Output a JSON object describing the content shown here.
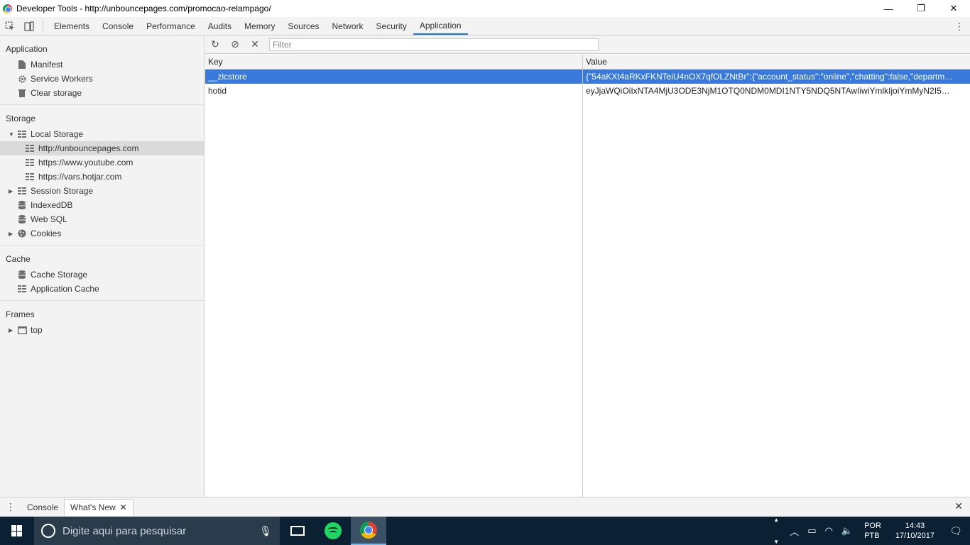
{
  "window": {
    "title": "Developer Tools - http://unbouncepages.com/promocao-relampago/",
    "controls": {
      "minimize": "—",
      "maximize": "❐",
      "close": "✕"
    }
  },
  "devtools_tabs": [
    "Elements",
    "Console",
    "Performance",
    "Audits",
    "Memory",
    "Sources",
    "Network",
    "Security",
    "Application"
  ],
  "active_tab": "Application",
  "sidebar": {
    "application": {
      "title": "Application",
      "items": [
        {
          "label": "Manifest",
          "icon": "file-icon"
        },
        {
          "label": "Service Workers",
          "icon": "gear-icon"
        },
        {
          "label": "Clear storage",
          "icon": "trash-icon"
        }
      ]
    },
    "storage": {
      "title": "Storage",
      "local_storage": "Local Storage",
      "local_origins": [
        "http://unbouncepages.com",
        "https://www.youtube.com",
        "https://vars.hotjar.com"
      ],
      "session_storage": "Session Storage",
      "indexeddb": "IndexedDB",
      "websql": "Web SQL",
      "cookies": "Cookies"
    },
    "cache": {
      "title": "Cache",
      "cache_storage": "Cache Storage",
      "application_cache": "Application Cache"
    },
    "frames": {
      "title": "Frames",
      "top": "top"
    }
  },
  "toolbar": {
    "filter_placeholder": "Filter"
  },
  "table": {
    "headers": {
      "key": "Key",
      "value": "Value"
    },
    "rows": [
      {
        "key": "__zlcstore",
        "value": "{\"54aKXt4aRKxFKNTeiU4nOX7qfOLZNtBr\":{\"account_status\":\"online\",\"chatting\":false,\"department..."
      },
      {
        "key": "hotid",
        "value": "eyJjaWQiOiIxNTA4MjU3ODE3NjM1OTQ0NDM0MDI1NTY5NDQ5NTAwIiwiYmlkIjoiYmMyN2I5ZTN..."
      }
    ]
  },
  "drawer": {
    "tabs": [
      "Console",
      "What's New"
    ],
    "active": "What's New"
  },
  "taskbar": {
    "search_placeholder": "Digite aqui para pesquisar",
    "lang_line1": "POR",
    "lang_line2": "PTB",
    "time": "14:43",
    "date": "17/10/2017"
  }
}
